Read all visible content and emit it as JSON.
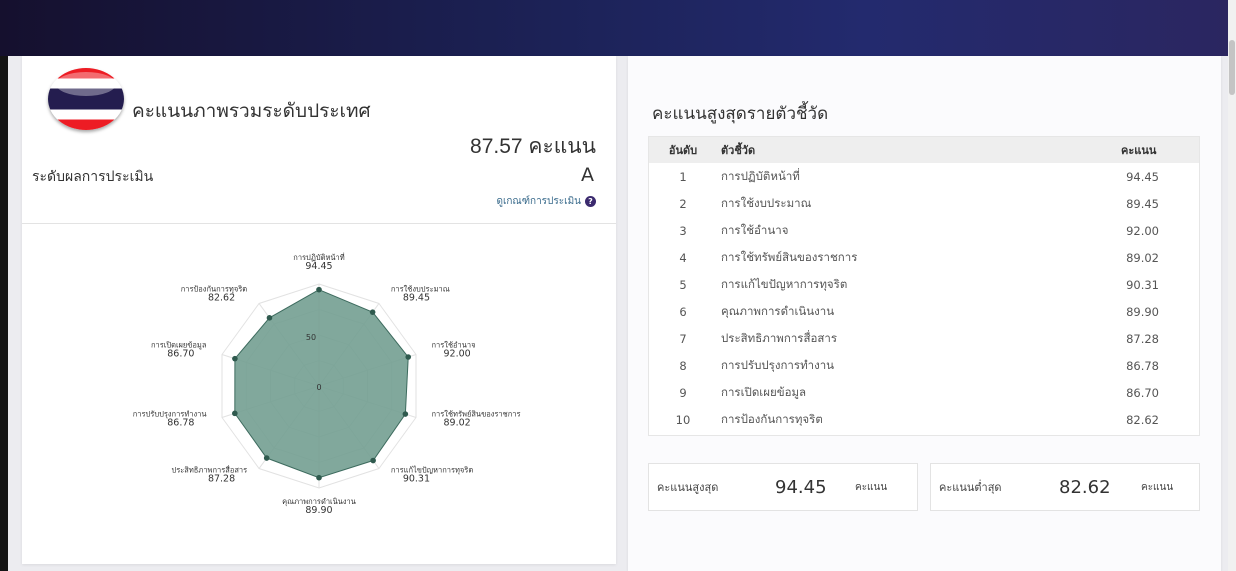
{
  "country_card": {
    "title": "คะแนนภาพรวมระดับประเทศ",
    "score_value": "87.57",
    "score_unit": "คะแนน",
    "level_label": "ระดับผลการประเมิน",
    "level_value": "A",
    "criteria_link": "ดูเกณฑ์การประเมิน",
    "flag_icon": "thailand-flag-icon"
  },
  "chart_data": {
    "type": "radar",
    "categories": [
      "การปฏิบัติหน้าที่",
      "การใช้งบประมาณ",
      "การใช้อำนาจ",
      "การใช้ทรัพย์สินของราชการ",
      "การแก้ไขปัญหาการทุจริต",
      "คุณภาพการดำเนินงาน",
      "ประสิทธิภาพการสื่อสาร",
      "การปรับปรุงการทำงาน",
      "การเปิดเผยข้อมูล",
      "การป้องกันการทุจริต"
    ],
    "values": [
      94.45,
      89.45,
      92.0,
      89.02,
      90.31,
      89.9,
      87.28,
      86.78,
      86.7,
      82.62
    ],
    "value_labels": [
      "94.45",
      "89.45",
      "92.00",
      "89.02",
      "90.31",
      "89.90",
      "87.28",
      "86.78",
      "86.70",
      "82.62"
    ],
    "scale_labels": [
      "0",
      "50"
    ],
    "rlim": [
      0,
      100
    ],
    "fill_color": "#739f91",
    "stroke_color": "#3d6b5e"
  },
  "ranking": {
    "title": "คะแนนสูงสุดรายตัวชี้วัด",
    "headers": {
      "rank": "อันดับ",
      "indicator": "ตัวชี้วัด",
      "score": "คะแนน"
    },
    "rows": [
      {
        "rank": "1",
        "indicator": "การปฏิบัติหน้าที่",
        "score": "94.45"
      },
      {
        "rank": "2",
        "indicator": "การใช้งบประมาณ",
        "score": "89.45"
      },
      {
        "rank": "3",
        "indicator": "การใช้อำนาจ",
        "score": "92.00"
      },
      {
        "rank": "4",
        "indicator": "การใช้ทรัพย์สินของราชการ",
        "score": "89.02"
      },
      {
        "rank": "5",
        "indicator": "การแก้ไขปัญหาการทุจริต",
        "score": "90.31"
      },
      {
        "rank": "6",
        "indicator": "คุณภาพการดำเนินงาน",
        "score": "89.90"
      },
      {
        "rank": "7",
        "indicator": "ประสิทธิภาพการสื่อสาร",
        "score": "87.28"
      },
      {
        "rank": "8",
        "indicator": "การปรับปรุงการทำงาน",
        "score": "86.78"
      },
      {
        "rank": "9",
        "indicator": "การเปิดเผยข้อมูล",
        "score": "86.70"
      },
      {
        "rank": "10",
        "indicator": "การป้องกันการทุจริต",
        "score": "82.62"
      }
    ]
  },
  "stats": {
    "high_label": "คะแนนสูงสุด",
    "high_value": "94.45",
    "low_label": "คะแนนต่ำสุด",
    "low_value": "82.62",
    "unit": "คะแนน"
  }
}
